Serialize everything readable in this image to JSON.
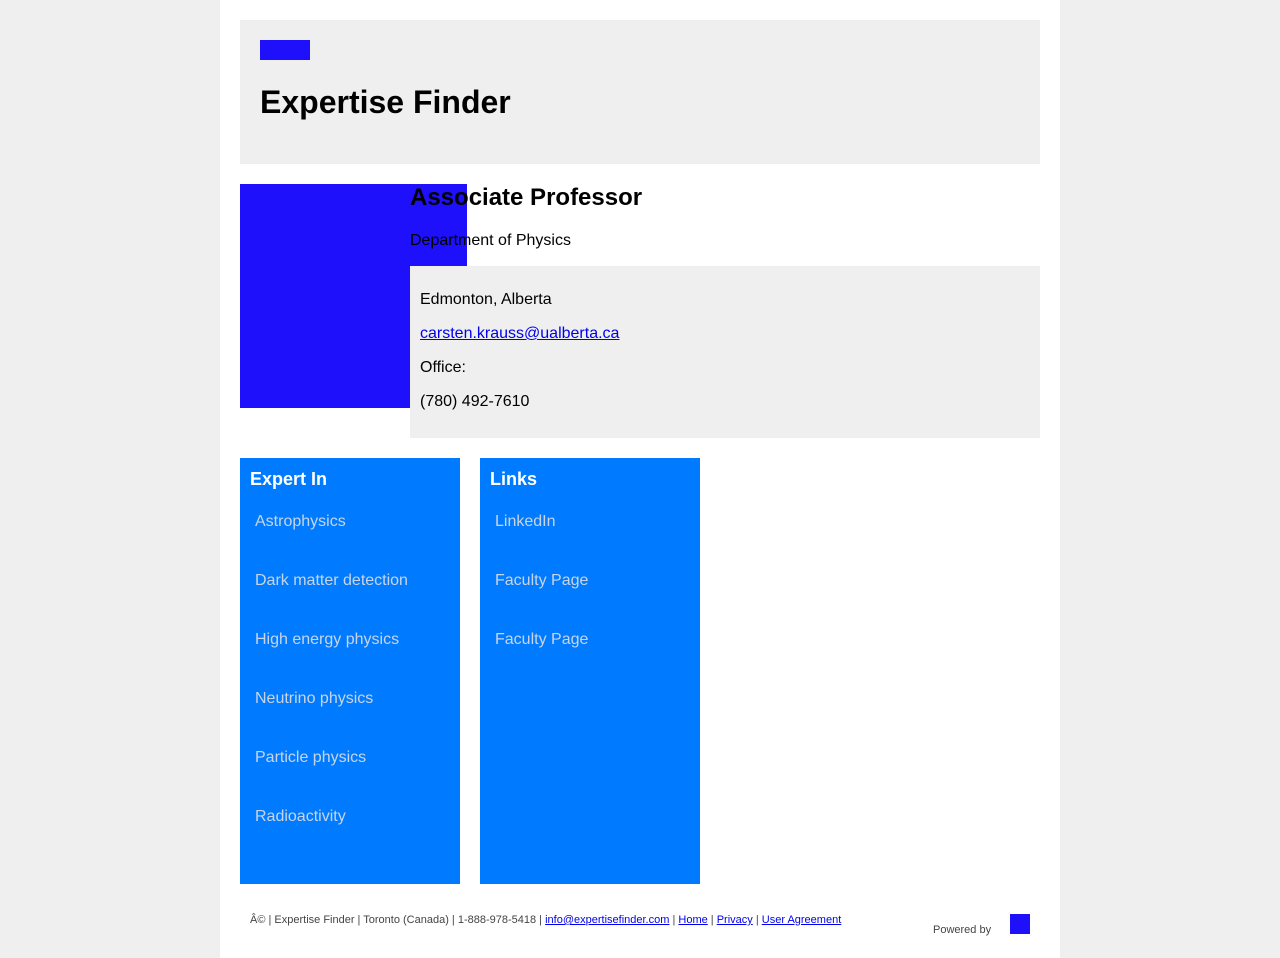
{
  "colors": {
    "page_background": "#efefef",
    "brand_blue": "#1e10fb",
    "panel_blue": "#007bff",
    "link": "#0000ee"
  },
  "header": {
    "logo_icon": "site-logo",
    "title": "Expertise Finder"
  },
  "profile": {
    "photo_icon": "profile-photo",
    "job_title": "Associate Professor",
    "department": "Department of Physics",
    "contact": {
      "location": "Edmonton, Alberta",
      "email": "carsten.krauss@ualberta.ca",
      "office_label": "Office:",
      "phone": "(780) 492-7610"
    }
  },
  "expert_in": {
    "heading": "Expert In",
    "items": [
      "Astrophysics",
      "Dark matter detection",
      "High energy physics",
      "Neutrino physics",
      "Particle physics",
      "Radioactivity"
    ]
  },
  "links": {
    "heading": "Links",
    "items": [
      "LinkedIn",
      "Faculty Page",
      "Faculty Page"
    ]
  },
  "footer": {
    "prefix": "Â© | Expertise Finder | Toronto (Canada) | 1-888-978-5418 | ",
    "email": "info@expertisefinder.com",
    "sep": " | ",
    "home": "Home",
    "privacy": "Privacy",
    "agreement": "User Agreement",
    "powered_by": "Powered by",
    "powered_logo_icon": "powered-by-logo"
  }
}
